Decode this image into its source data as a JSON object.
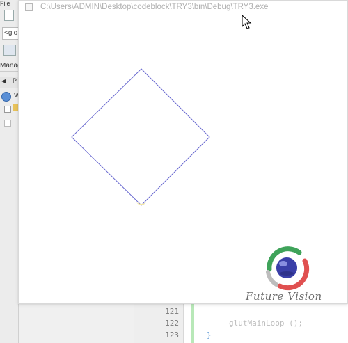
{
  "ide": {
    "menu_text": "File",
    "scope_combo": "<glo",
    "management_label": "Manag",
    "tab_label": "P",
    "workspace_label": "W",
    "line_numbers": [
      "121",
      "122",
      "123"
    ],
    "code": {
      "line_122": "glutMainLoop ();",
      "line_123": "}"
    }
  },
  "window": {
    "title": "C:\\Users\\ADMIN\\Desktop\\codeblock\\TRY3\\bin\\Debug\\TRY3.exe"
  },
  "canvas": {
    "shape": "diamond",
    "outline_color": "#6a6ad0",
    "highlight_color": "#f2e6a6"
  },
  "logo": {
    "text": "Future Vision",
    "ring_colors": [
      "#3fa35a",
      "#e05050"
    ],
    "sphere_color": "#3a3fa8"
  },
  "cursor": {
    "icon": "arrow-cursor-icon"
  }
}
